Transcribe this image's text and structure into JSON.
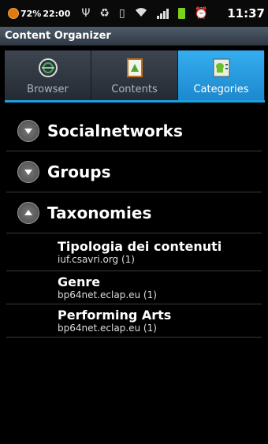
{
  "status": {
    "battery_pct": "72%",
    "alarm_time": "22:00",
    "clock": "11:37"
  },
  "app": {
    "title": "Content Organizer"
  },
  "tabs": [
    {
      "label": "Browser",
      "icon": "globe-icon",
      "active": false
    },
    {
      "label": "Contents",
      "icon": "document-icon",
      "active": false
    },
    {
      "label": "Categories",
      "icon": "android-list-icon",
      "active": true
    }
  ],
  "groups": [
    {
      "title": "Socialnetworks",
      "expanded": false,
      "children": []
    },
    {
      "title": "Groups",
      "expanded": false,
      "children": []
    },
    {
      "title": "Taxonomies",
      "expanded": true,
      "children": [
        {
          "title": "Tipologia dei contenuti",
          "subtitle": "iuf.csavri.org (1)"
        },
        {
          "title": "Genre",
          "subtitle": "bp64net.eclap.eu (1)"
        },
        {
          "title": "Performing Arts",
          "subtitle": "bp64net.eclap.eu (1)"
        }
      ]
    }
  ],
  "colors": {
    "accent": "#1da0e0",
    "tab_active": "#2a9be0",
    "title_bar": "#3c4753"
  }
}
